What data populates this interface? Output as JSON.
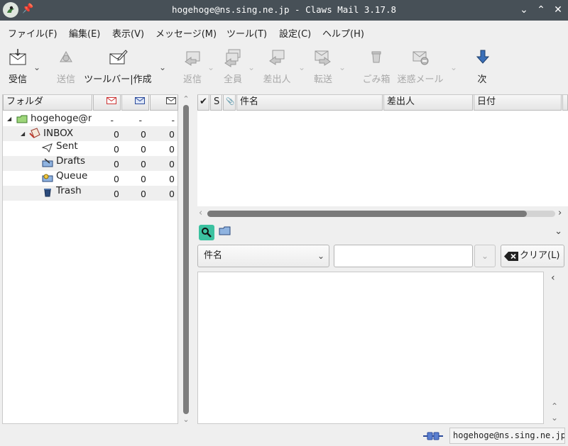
{
  "window": {
    "title": "hogehoge@ns.sing.ne.jp - Claws Mail 3.17.8",
    "icons": [
      "claws-mail-app-icon",
      "pin-icon"
    ],
    "controls": [
      "minimize",
      "maximize",
      "close"
    ]
  },
  "menubar": {
    "items": [
      "ファイル(F)",
      "編集(E)",
      "表示(V)",
      "メッセージ(M)",
      "ツール(T)",
      "設定(C)",
      "ヘルプ(H)"
    ]
  },
  "toolbar": {
    "buttons": [
      {
        "label": "受信",
        "icon": "receive-mail-icon",
        "enabled": true,
        "has_menu": true
      },
      {
        "label": "送信",
        "icon": "send-queue-icon",
        "enabled": false,
        "has_menu": false
      },
      {
        "label": "ツールバー|作成",
        "icon": "compose-icon",
        "enabled": true,
        "has_menu": true
      },
      {
        "label": "返信",
        "icon": "reply-icon",
        "enabled": false,
        "has_menu": true
      },
      {
        "label": "全員",
        "icon": "reply-all-icon",
        "enabled": false,
        "has_menu": true
      },
      {
        "label": "差出人",
        "icon": "reply-sender-icon",
        "enabled": false,
        "has_menu": true
      },
      {
        "label": "転送",
        "icon": "forward-icon",
        "enabled": false,
        "has_menu": true
      },
      {
        "label": "ごみ箱",
        "icon": "trash-icon",
        "enabled": false,
        "has_menu": false
      },
      {
        "label": "迷惑メール",
        "icon": "spam-icon",
        "enabled": false,
        "has_menu": true
      },
      {
        "label": "次",
        "icon": "next-arrow-icon",
        "enabled": true,
        "has_menu": false
      }
    ]
  },
  "folder_pane": {
    "columns": [
      "フォルダ",
      "new-mail-icon",
      "unread-mail-icon",
      "total-mail-icon"
    ],
    "rows": [
      {
        "name": "hogehoge@ns.sing.ne.jp",
        "counts": [
          "-",
          "-",
          "-"
        ],
        "icon": "mailbox-icon",
        "expanded": true
      },
      {
        "name": "INBOX",
        "counts": [
          "0",
          "0",
          "0"
        ],
        "icon": "inbox-icon",
        "expanded": true
      },
      {
        "name": "Sent",
        "counts": [
          "0",
          "0",
          "0"
        ],
        "icon": "sent-folder-icon"
      },
      {
        "name": "Drafts",
        "counts": [
          "0",
          "0",
          "0"
        ],
        "icon": "drafts-folder-icon"
      },
      {
        "name": "Queue",
        "counts": [
          "0",
          "0",
          "0"
        ],
        "icon": "queue-folder-icon"
      },
      {
        "name": "Trash",
        "counts": [
          "0",
          "0",
          "0"
        ],
        "icon": "trash-folder-icon"
      }
    ]
  },
  "message_list": {
    "columns": [
      "✔",
      "S",
      "📎",
      "件名",
      "差出人",
      "日付"
    ]
  },
  "quick_search": {
    "field_select": "件名",
    "query": "",
    "clear_label": "クリア(L)"
  },
  "statusbar": {
    "account": "hogehoge@ns.sing.ne.jp",
    "connection_icon": "online-plug-icon"
  },
  "colors": {
    "titlebar": "#475057",
    "search_toggle": "#3cc1a0",
    "window_bg": "#efefef"
  }
}
